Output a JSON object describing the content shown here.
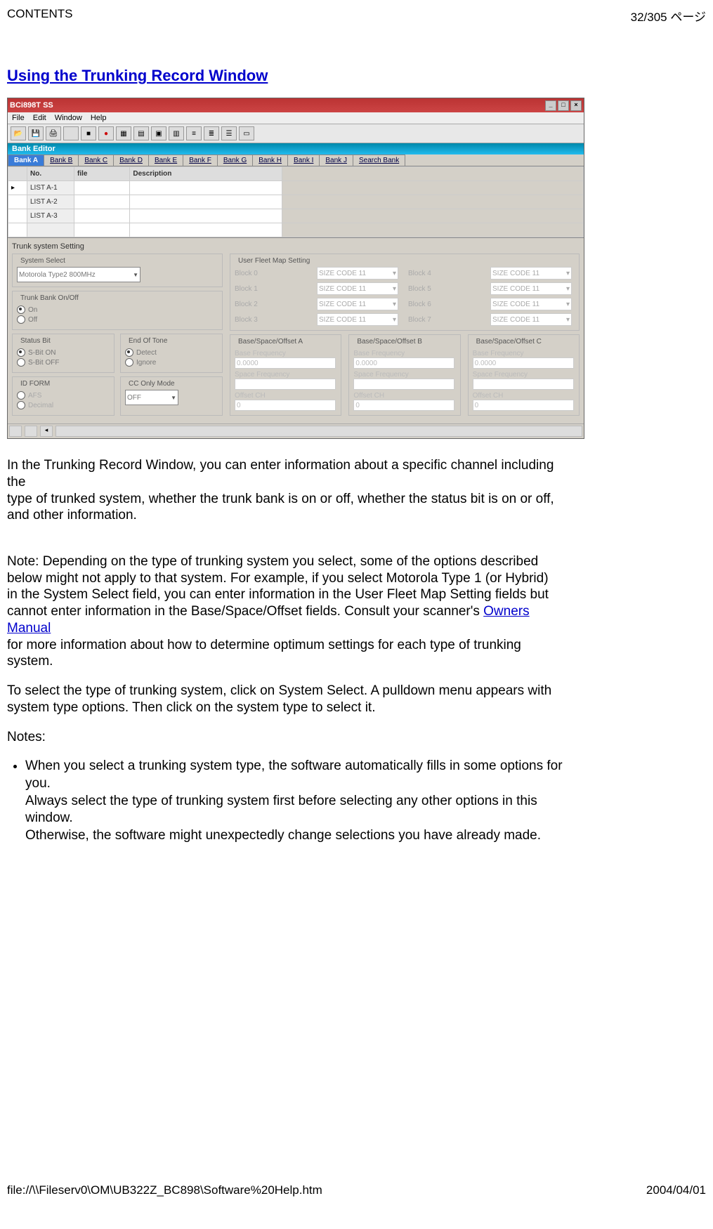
{
  "header": {
    "left": "CONTENTS",
    "right": "32/305 ページ"
  },
  "footer": {
    "left": "file://\\\\Fileserv0\\OM\\UB322Z_BC898\\Software%20Help.htm",
    "right": "2004/04/01"
  },
  "title": "Using the Trunking Record Window",
  "body": {
    "p1": "In the Trunking Record Window, you can enter information about a specific channel including the\ntype of trunked system, whether the trunk bank is on or off, whether the status bit is on or off,\nand other information.",
    "p2a": "Note: Depending on the type of trunking system you select, some of the options described\nbelow might not apply to that system. For example, if you select Motorola Type 1 (or Hybrid)\nin the System Select field, you can enter information in the User Fleet Map Setting fields but\ncannot enter information in the Base/Space/Offset fields. Consult your scanner's ",
    "p2link": "Owners Manual",
    "p2b": "\nfor more information about how to determine optimum settings for each type of trunking system.",
    "p3": "To select the type of trunking system, click on System Select. A pulldown menu appears with\nsystem type options. Then click on the system type to select it.",
    "notes_label": "Notes:",
    "note1": "When you select a trunking system type, the software automatically fills in some options for you.\nAlways select the type of trunking system first before selecting any other options in this window.\nOtherwise, the software might unexpectedly change selections you have already made."
  },
  "app": {
    "title": "BCi898T SS",
    "menus": [
      "File",
      "Edit",
      "Window",
      "Help"
    ],
    "child_title": "Bank Editor",
    "tabs": [
      "Bank A",
      "Bank B",
      "Bank C",
      "Bank D",
      "Bank E",
      "Bank F",
      "Bank G",
      "Bank H",
      "Bank I",
      "Bank J",
      "Search Bank"
    ],
    "grid_headers": [
      "No.",
      "file",
      "Description"
    ],
    "grid_rows": [
      "LIST A-1",
      "LIST A-2",
      "LIST A-3"
    ],
    "trunk_title": "Trunk system Setting",
    "system_select_label": "System Select",
    "system_select_value": "Motorola Type2 800MHz",
    "bank_onoff_label": "Trunk Bank On/Off",
    "on_label": "On",
    "off_label": "Off",
    "status_bit_label": "Status Bit",
    "sbit_on": "S-Bit ON",
    "sbit_off": "S-Bit OFF",
    "eot_label": "End Of Tone",
    "eot_detect": "Detect",
    "eot_ignore": "Ignore",
    "idform_label": "ID FORM",
    "idform_afs": "AFS",
    "idform_dec": "Decimal",
    "cc_label": "CC Only Mode",
    "cc_value": "OFF",
    "fleet_label": "User Fleet Map Setting",
    "fleet_blocks": [
      "Block 0",
      "Block 1",
      "Block 2",
      "Block 3",
      "Block 4",
      "Block 5",
      "Block 6",
      "Block 7"
    ],
    "fleet_val": "SIZE CODE 11",
    "bso_labels": [
      "Base/Space/Offset A",
      "Base/Space/Offset B",
      "Base/Space/Offset C"
    ],
    "bso_base": "Base Frequency",
    "bso_base_val": "0.0000",
    "bso_space": "Space Frequency",
    "bso_offset": "Offset CH",
    "bso_offset_val": "0"
  }
}
